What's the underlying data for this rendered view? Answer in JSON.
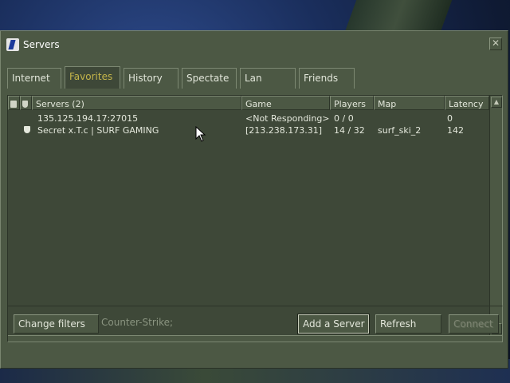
{
  "window": {
    "title": "Servers",
    "close": "✕"
  },
  "tabs": [
    {
      "label": "Internet",
      "active": false
    },
    {
      "label": "Favorites",
      "active": true
    },
    {
      "label": "History",
      "active": false
    },
    {
      "label": "Spectate",
      "active": false
    },
    {
      "label": "Lan",
      "active": false
    },
    {
      "label": "Friends",
      "active": false
    }
  ],
  "columns": {
    "servers": "Servers (2)",
    "game": "Game",
    "players": "Players",
    "map": "Map",
    "latency": "Latency"
  },
  "rows": [
    {
      "name": "135.125.194.17:27015",
      "game": "<Not Responding>",
      "players": "0 / 0",
      "map": "",
      "latency": "0",
      "secure": false
    },
    {
      "name": "Secret x.T.c | SURF GAMING",
      "game": "[213.238.173.31]",
      "players": "14 / 32",
      "map": "surf_ski_2",
      "latency": "142",
      "secure": true
    }
  ],
  "bottom": {
    "change_filters": "Change filters",
    "filter_text": "Counter-Strike;",
    "add_server": "Add a Server",
    "refresh": "Refresh",
    "connect": "Connect"
  },
  "colors": {
    "window_bg": "#4c5844",
    "active_tab_text": "#c4b54a",
    "list_bg": "#3e4838"
  }
}
